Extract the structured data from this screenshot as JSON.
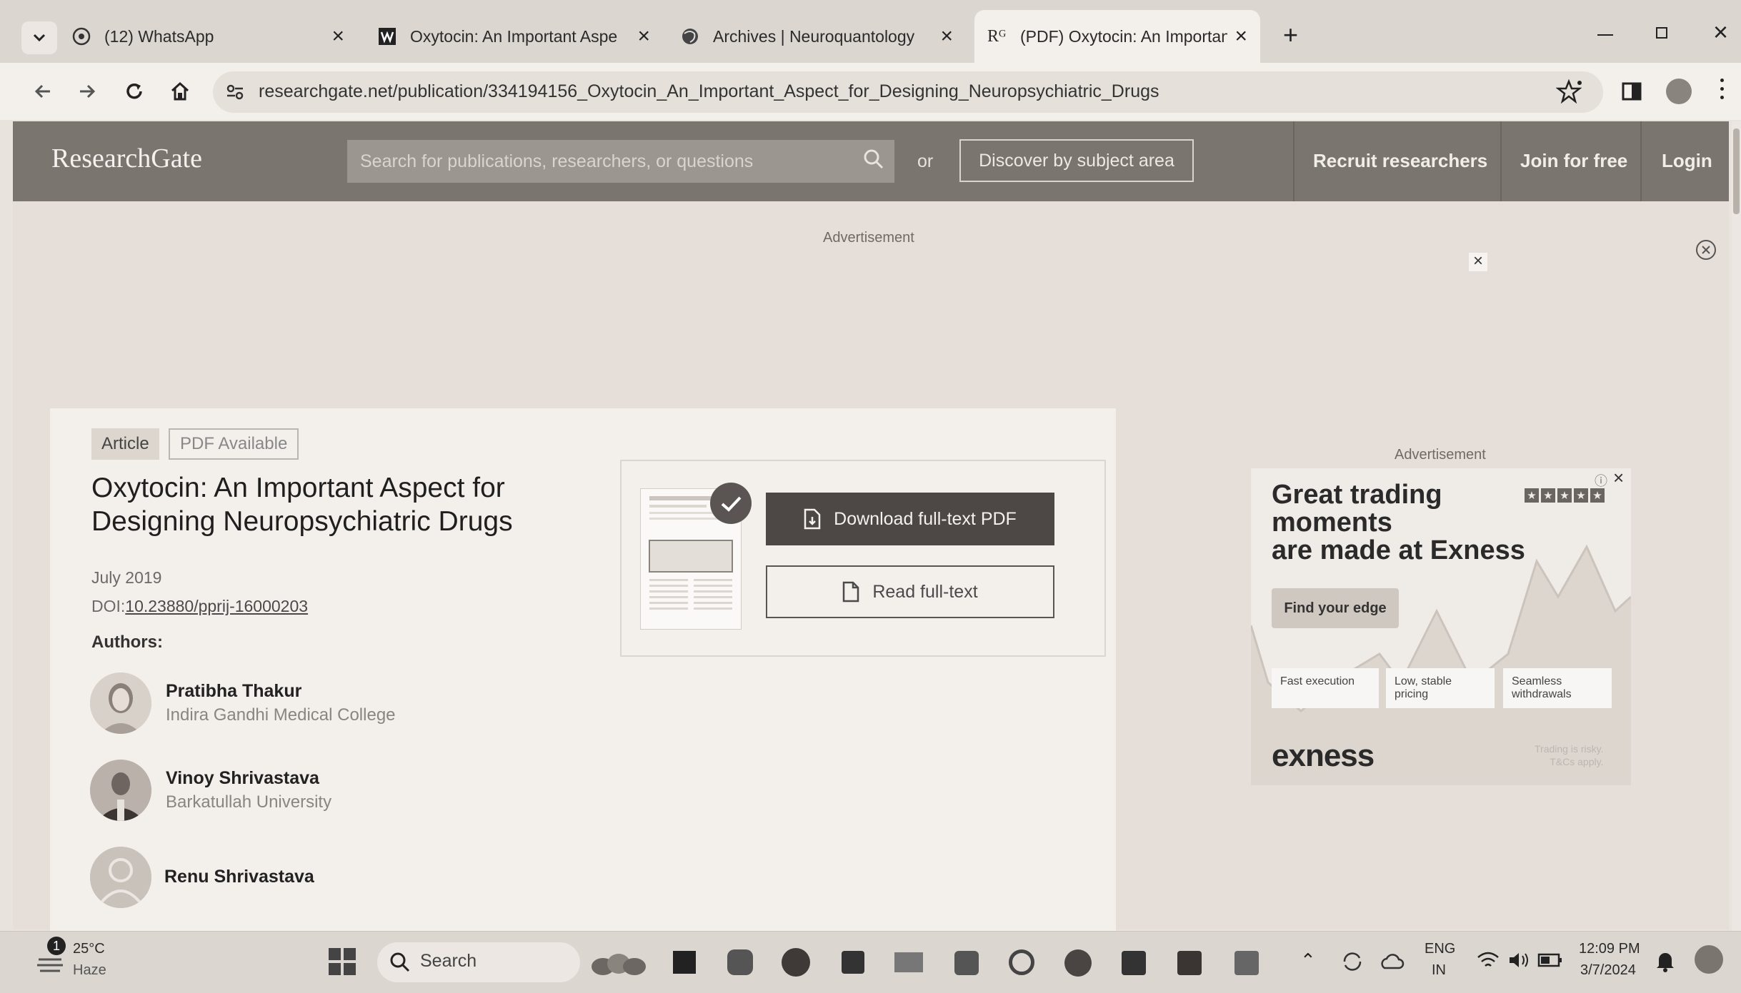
{
  "browser": {
    "tabs": [
      {
        "title": "(12) WhatsApp",
        "icon": "whatsapp-icon"
      },
      {
        "title": "Oxytocin: An Important Aspect",
        "icon": "journal-icon"
      },
      {
        "title": "Archives | Neuroquantology",
        "icon": "globe-icon"
      },
      {
        "title": "(PDF) Oxytocin: An Important A",
        "icon": "researchgate-icon"
      }
    ],
    "url": "researchgate.net/publication/334194156_Oxytocin_An_Important_Aspect_for_Designing_Neuropsychiatric_Drugs",
    "new_tab": "+"
  },
  "header": {
    "logo": "ResearchGate",
    "search_placeholder": "Search for publications, researchers, or questions",
    "or": "or",
    "discover": "Discover by subject area",
    "nav": [
      "Recruit researchers",
      "Join for free",
      "Login"
    ]
  },
  "ads": {
    "top_label": "Advertisement",
    "side_label": "Advertisement",
    "side": {
      "headline_1": "Great trading",
      "headline_2": "moments",
      "headline_3": "are made at Exness",
      "cta": "Find your edge",
      "features": [
        "Fast execution",
        "Low, stable pricing",
        "Seamless withdrawals"
      ],
      "brand": "exness",
      "fine_1": "Trading is risky.",
      "fine_2": "T&Cs apply."
    }
  },
  "article": {
    "tags": [
      "Article",
      "PDF Available"
    ],
    "title_line_1": "Oxytocin: An Important Aspect for",
    "title_line_2": "Designing Neuropsychiatric Drugs",
    "date": "July 2019",
    "doi_label": "DOI:",
    "doi": "10.23880/pprij-16000203",
    "authors_label": "Authors:",
    "authors": [
      {
        "name": "Pratibha Thakur",
        "affiliation": "Indira Gandhi Medical College"
      },
      {
        "name": "Vinoy Shrivastava",
        "affiliation": "Barkatullah University"
      },
      {
        "name": "Renu Shrivastava",
        "affiliation": ""
      }
    ],
    "download_btn": "Download full-text PDF",
    "read_btn": "Read full-text"
  },
  "taskbar": {
    "weather_temp": "25°C",
    "weather_desc": "Haze",
    "weather_badge": "1",
    "search": "Search",
    "lang_1": "ENG",
    "lang_2": "IN",
    "time": "12:09 PM",
    "date": "3/7/2024"
  },
  "colors": {
    "rg_header": "#7b7570",
    "download_button": "#4d4845",
    "page_bg": "#e6dfd9"
  }
}
